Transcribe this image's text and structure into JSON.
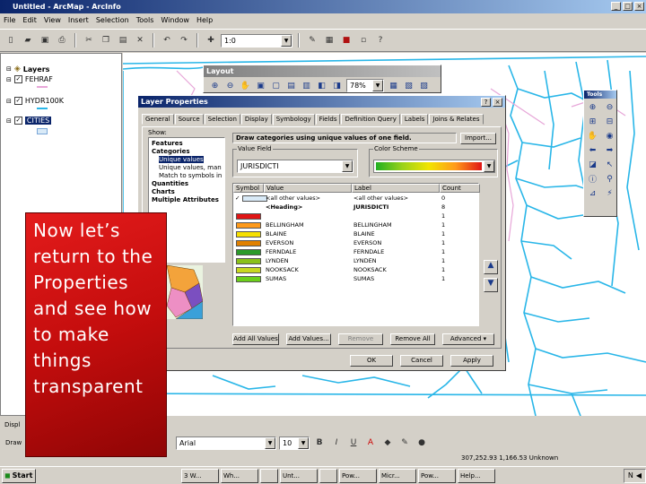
{
  "app": {
    "title": "Untitled - ArcMap - ArcInfo"
  },
  "menu": [
    "File",
    "Edit",
    "View",
    "Insert",
    "Selection",
    "Tools",
    "Window",
    "Help"
  ],
  "toolbar": {
    "scale_value": "1:0"
  },
  "toc": {
    "root_label": "Layers",
    "layers": [
      {
        "name": "FEHRAF",
        "checked": true
      },
      {
        "name": "HYDR100K",
        "checked": true
      },
      {
        "name": "CITIES",
        "checked": true
      }
    ],
    "bottom_tab": "Displ"
  },
  "layout_toolbar": {
    "title": "Layout",
    "zoom": "78%"
  },
  "dialog": {
    "title": "Layer Properties",
    "tabs": [
      "General",
      "Source",
      "Selection",
      "Display",
      "Symbology",
      "Fields",
      "Definition Query",
      "Labels",
      "Joins & Relates"
    ],
    "active_tab": "Symbology",
    "show_label": "Show:",
    "tree": [
      {
        "label": "Features",
        "bold": true
      },
      {
        "label": "Categories",
        "bold": true
      },
      {
        "label": "Unique values",
        "bold": false,
        "selected": true
      },
      {
        "label": "Unique values, many f",
        "bold": false
      },
      {
        "label": "Match to symbols in a",
        "bold": false
      },
      {
        "label": "Quantities",
        "bold": true
      },
      {
        "label": "Charts",
        "bold": true
      },
      {
        "label": "Multiple Attributes",
        "bold": true
      }
    ],
    "heading": "Draw categories using unique values of one field.",
    "import_label": "Import...",
    "value_field_label": "Value Field",
    "value_field": "JURISDICTI",
    "color_scheme_label": "Color Scheme",
    "grid_headers": [
      "Symbol",
      "Value",
      "Label",
      "Count"
    ],
    "rows": [
      {
        "value": "<all other values>",
        "label": "<all other values>",
        "count": "0",
        "color": "#d9eaf7",
        "checked": true
      },
      {
        "value": "<Heading>",
        "label": "JURISDICTI",
        "count": "8",
        "color": "",
        "heading": true
      },
      {
        "value": "",
        "label": "",
        "count": "1",
        "color": "#e01515"
      },
      {
        "value": "BELLINGHAM",
        "label": "BELLINGHAM",
        "count": "1",
        "color": "#ff9a1a"
      },
      {
        "value": "BLAINE",
        "label": "BLAINE",
        "count": "1",
        "color": "#f7e000"
      },
      {
        "value": "EVERSON",
        "label": "EVERSON",
        "count": "1",
        "color": "#e08000"
      },
      {
        "value": "FERNDALE",
        "label": "FERNDALE",
        "count": "1",
        "color": "#2a9a2a"
      },
      {
        "value": "LYNDEN",
        "label": "LYNDEN",
        "count": "1",
        "color": "#8ac11a"
      },
      {
        "value": "NOOKSACK",
        "label": "NOOKSACK",
        "count": "1",
        "color": "#c8d820"
      },
      {
        "value": "SUMAS",
        "label": "SUMAS",
        "count": "1",
        "color": "#6bcf1a"
      }
    ],
    "buttons": {
      "add_all": "Add All Values",
      "add": "Add Values...",
      "remove": "Remove",
      "remove_all": "Remove All",
      "advanced": "Advanced"
    },
    "footer": {
      "ok": "OK",
      "cancel": "Cancel",
      "apply": "Apply"
    }
  },
  "tools": {
    "title": "Tools"
  },
  "callout": {
    "text": "Now let’s return to the Properties and see how to make things transparent"
  },
  "draw_toolbar": {
    "draw_label": "Draw",
    "font": "Arial",
    "size": "10"
  },
  "status": {
    "coords": "307,252.93  1,166.53 Unknown"
  },
  "taskbar": {
    "start": "Start",
    "tasks": [
      "3 W...",
      "Wh...",
      "",
      "Unt...",
      "",
      "Pow...",
      "Micr...",
      "Pow...",
      "Help..."
    ],
    "tray": "N"
  },
  "colors": {
    "river": "#29b6e8",
    "boundary": "#e7a6d8",
    "accent": "#0a246a"
  }
}
